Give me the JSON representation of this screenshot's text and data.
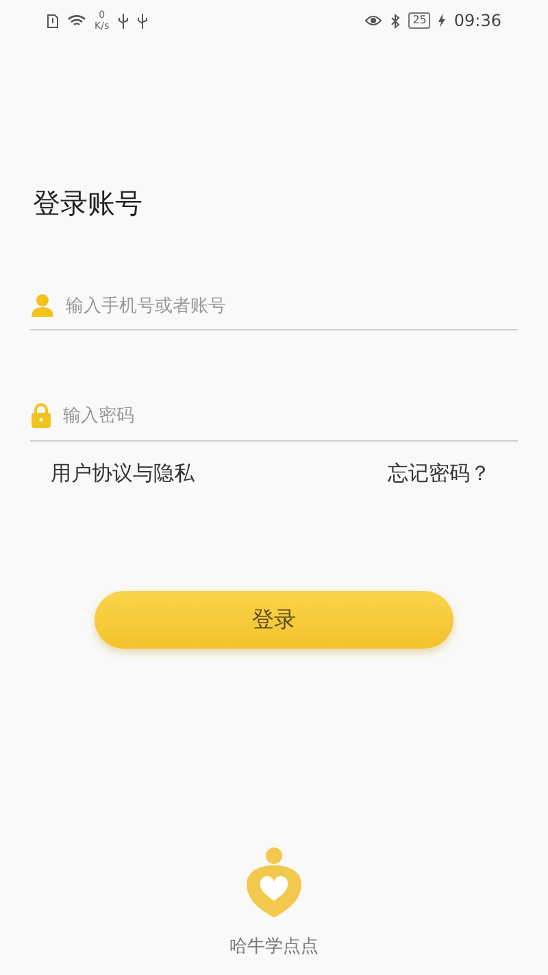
{
  "status_bar": {
    "speed_value": "0",
    "speed_unit": "K/s",
    "battery": "25",
    "time": "09:36"
  },
  "title": "登录账号",
  "fields": [
    {
      "kind": "account",
      "placeholder": "输入手机号或者账号"
    },
    {
      "kind": "password",
      "placeholder": "输入密码"
    }
  ],
  "links": {
    "agreement": "用户协议与隐私",
    "forgot": "忘记密码？"
  },
  "login_button": "登录",
  "footer": {
    "app_name": "哈牛学点点"
  }
}
